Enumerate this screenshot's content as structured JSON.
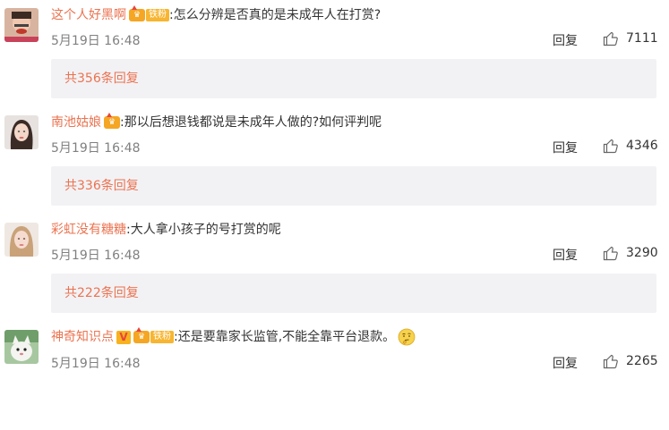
{
  "comments": [
    {
      "username": "这个人好黑啊",
      "fan_tag": "铁粉",
      "has_v": false,
      "text": "怎么分辨是否真的是未成年人在打赏?",
      "emoji": "",
      "time": "5月19日 16:48",
      "reply_label": "回复",
      "likes": "7111",
      "replies_label": "共356条回复"
    },
    {
      "username": "南池姑娘",
      "fan_tag": "",
      "has_v": false,
      "text": "那以后想退钱都说是未成年人做的?如何评判呢",
      "emoji": "",
      "time": "5月19日 16:48",
      "reply_label": "回复",
      "likes": "4346",
      "replies_label": "共336条回复"
    },
    {
      "username": "彩虹没有糖糖",
      "fan_tag": "",
      "has_v": false,
      "text": "大人拿小孩子的号打赏的呢",
      "emoji": "",
      "time": "5月19日 16:48",
      "reply_label": "回复",
      "likes": "3290",
      "replies_label": "共222条回复"
    },
    {
      "username": "神奇知识点",
      "fan_tag": "铁粉",
      "has_v": true,
      "text": "还是要靠家长监管,不能全靠平台退款。",
      "emoji": "thinking-face",
      "time": "5月19日 16:48",
      "reply_label": "回复",
      "likes": "2265",
      "replies_label": ""
    }
  ],
  "v_badge_glyph": "V",
  "colon": ":",
  "colors": {
    "username": "#eb7350",
    "timestamp": "#808080",
    "replies_background": "#f2f2f5",
    "vip_badge": "#f7b531"
  },
  "icons": {
    "like": "thumbs-up-outline-icon",
    "vip": "crown-vip-icon",
    "verified": "v-verified-icon",
    "emoji": "thinking-face-emoji"
  }
}
